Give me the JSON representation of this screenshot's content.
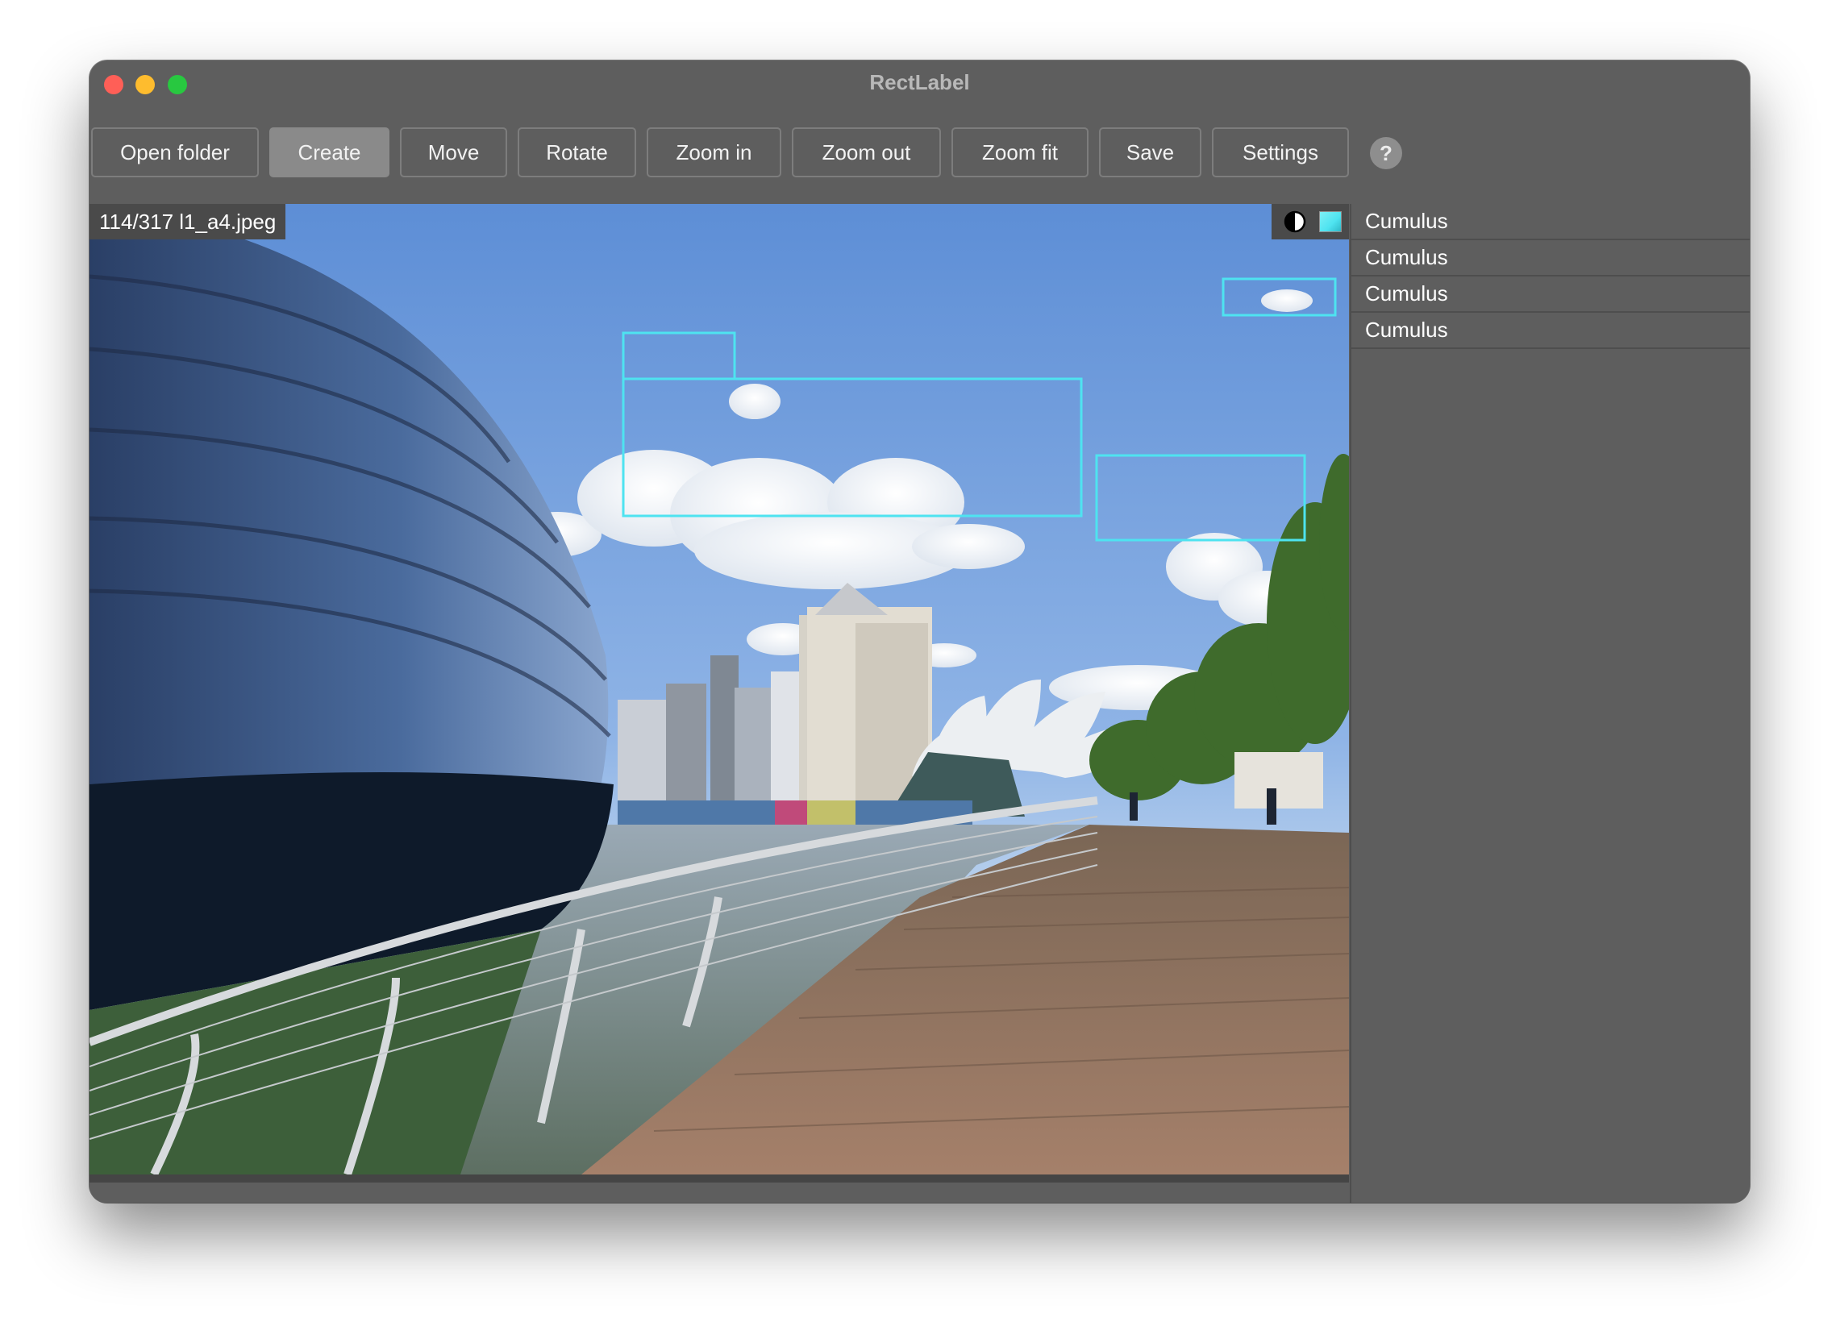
{
  "app": {
    "title": "RectLabel"
  },
  "toolbar": {
    "buttons": [
      {
        "label": "Open folder",
        "active": false
      },
      {
        "label": "Create",
        "active": true
      },
      {
        "label": "Move",
        "active": false
      },
      {
        "label": "Rotate",
        "active": false
      },
      {
        "label": "Zoom in",
        "active": false
      },
      {
        "label": "Zoom out",
        "active": false
      },
      {
        "label": "Zoom fit",
        "active": false
      },
      {
        "label": "Save",
        "active": false
      },
      {
        "label": "Settings",
        "active": false
      }
    ],
    "help_label": "?"
  },
  "image": {
    "filename": "114/317 l1_a4.jpeg",
    "box_color": "#4ee3f0",
    "annotations": [
      {
        "label": "Cumulus"
      },
      {
        "label": "Cumulus"
      },
      {
        "label": "Cumulus"
      },
      {
        "label": "Cumulus"
      },
      {
        "label": "Cumulus"
      }
    ]
  },
  "label_list": [
    {
      "label": "Cumulus"
    },
    {
      "label": "Cumulus"
    },
    {
      "label": "Cumulus"
    },
    {
      "label": "Cumulus"
    }
  ],
  "icons": {
    "contrast": "contrast-icon",
    "color": "color-swatch-icon",
    "color_swatch": "#4ee3f0"
  }
}
